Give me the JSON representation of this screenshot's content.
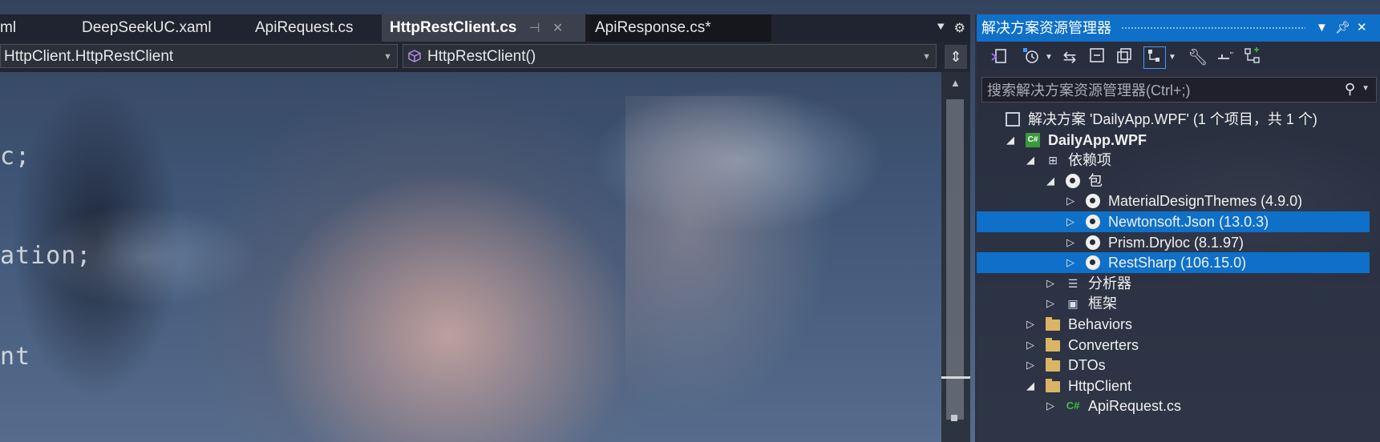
{
  "editor": {
    "tabs": [
      {
        "label": "ml"
      },
      {
        "label": "DeepSeekUC.xaml"
      },
      {
        "label": "ApiRequest.cs"
      },
      {
        "label": "HttpRestClient.cs",
        "active": true
      },
      {
        "label": "ApiResponse.cs*"
      }
    ],
    "pin_icon": "pin-icon",
    "close_icon": "close-icon",
    "nav": {
      "type_combo": "HttpClient.HttpRestClient",
      "member_combo": "HttpRestClient()"
    },
    "code_fragments": [
      "c;",
      "ation;",
      "nt"
    ]
  },
  "solution_explorer": {
    "title": "解决方案资源管理器",
    "search": {
      "placeholder": "搜索解决方案资源管理器(Ctrl+;)"
    },
    "tree": [
      {
        "label": "解决方案 'DailyApp.WPF' (1 个项目，共 1 个)",
        "icon": "solution-icon",
        "level": 0,
        "expander": ""
      },
      {
        "label": "DailyApp.WPF",
        "icon": "csharp-project-icon",
        "level": 1,
        "expander": "◢",
        "bold": true
      },
      {
        "label": "依赖项",
        "icon": "dependencies-icon",
        "level": 2,
        "expander": "◢"
      },
      {
        "label": "包",
        "icon": "package-icon",
        "level": 3,
        "expander": "◢"
      },
      {
        "label": "MaterialDesignThemes (4.9.0)",
        "icon": "package-icon",
        "level": 4,
        "expander": "▷"
      },
      {
        "label": "Newtonsoft.Json (13.0.3)",
        "icon": "package-icon",
        "level": 4,
        "expander": "▷",
        "selected": true
      },
      {
        "label": "Prism.Dryloc (8.1.97)",
        "icon": "package-icon",
        "level": 4,
        "expander": "▷"
      },
      {
        "label": "RestSharp (106.15.0)",
        "icon": "package-icon",
        "level": 4,
        "expander": "▷",
        "selected": true
      },
      {
        "label": "分析器",
        "icon": "analyzer-icon",
        "level": 3,
        "expander": "▷"
      },
      {
        "label": "框架",
        "icon": "framework-icon",
        "level": 3,
        "expander": "▷"
      },
      {
        "label": "Behaviors",
        "icon": "folder-icon",
        "level": 2,
        "expander": "▷"
      },
      {
        "label": "Converters",
        "icon": "folder-icon",
        "level": 2,
        "expander": "▷"
      },
      {
        "label": "DTOs",
        "icon": "folder-icon",
        "level": 2,
        "expander": "▷"
      },
      {
        "label": "HttpClient",
        "icon": "folder-icon",
        "level": 2,
        "expander": "◢"
      },
      {
        "label": "ApiRequest.cs",
        "icon": "csharp-file-icon",
        "level": 3,
        "expander": "▷"
      }
    ],
    "colors": {
      "accent": "#0e70c8",
      "folder": "#d9b565",
      "csharp": "#3a9a3a"
    }
  }
}
